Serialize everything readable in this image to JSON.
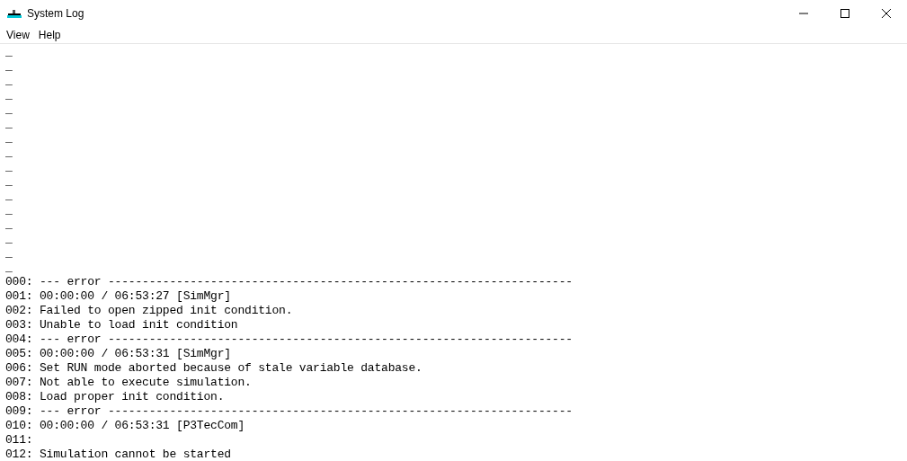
{
  "window": {
    "title": "System Log"
  },
  "menu": [
    "View",
    "Help"
  ],
  "log_lines": [
    "_",
    "_",
    "_",
    "_",
    "_",
    "_",
    "_",
    "_",
    "_",
    "_",
    "_",
    "_",
    "_",
    "_",
    "_",
    "_",
    "000: --- error --------------------------------------------------------------------",
    "001: 00:00:00 / 06:53:27 [SimMgr]",
    "002: Failed to open zipped init condition.",
    "003: Unable to load init condition",
    "004: --- error --------------------------------------------------------------------",
    "005: 00:00:00 / 06:53:31 [SimMgr]",
    "006: Set RUN mode aborted because of stale variable database.",
    "007: Not able to execute simulation.",
    "008: Load proper init condition.",
    "009: --- error --------------------------------------------------------------------",
    "010: 00:00:00 / 06:53:31 [P3TecCom]",
    "011:",
    "012: Simulation cannot be started"
  ]
}
